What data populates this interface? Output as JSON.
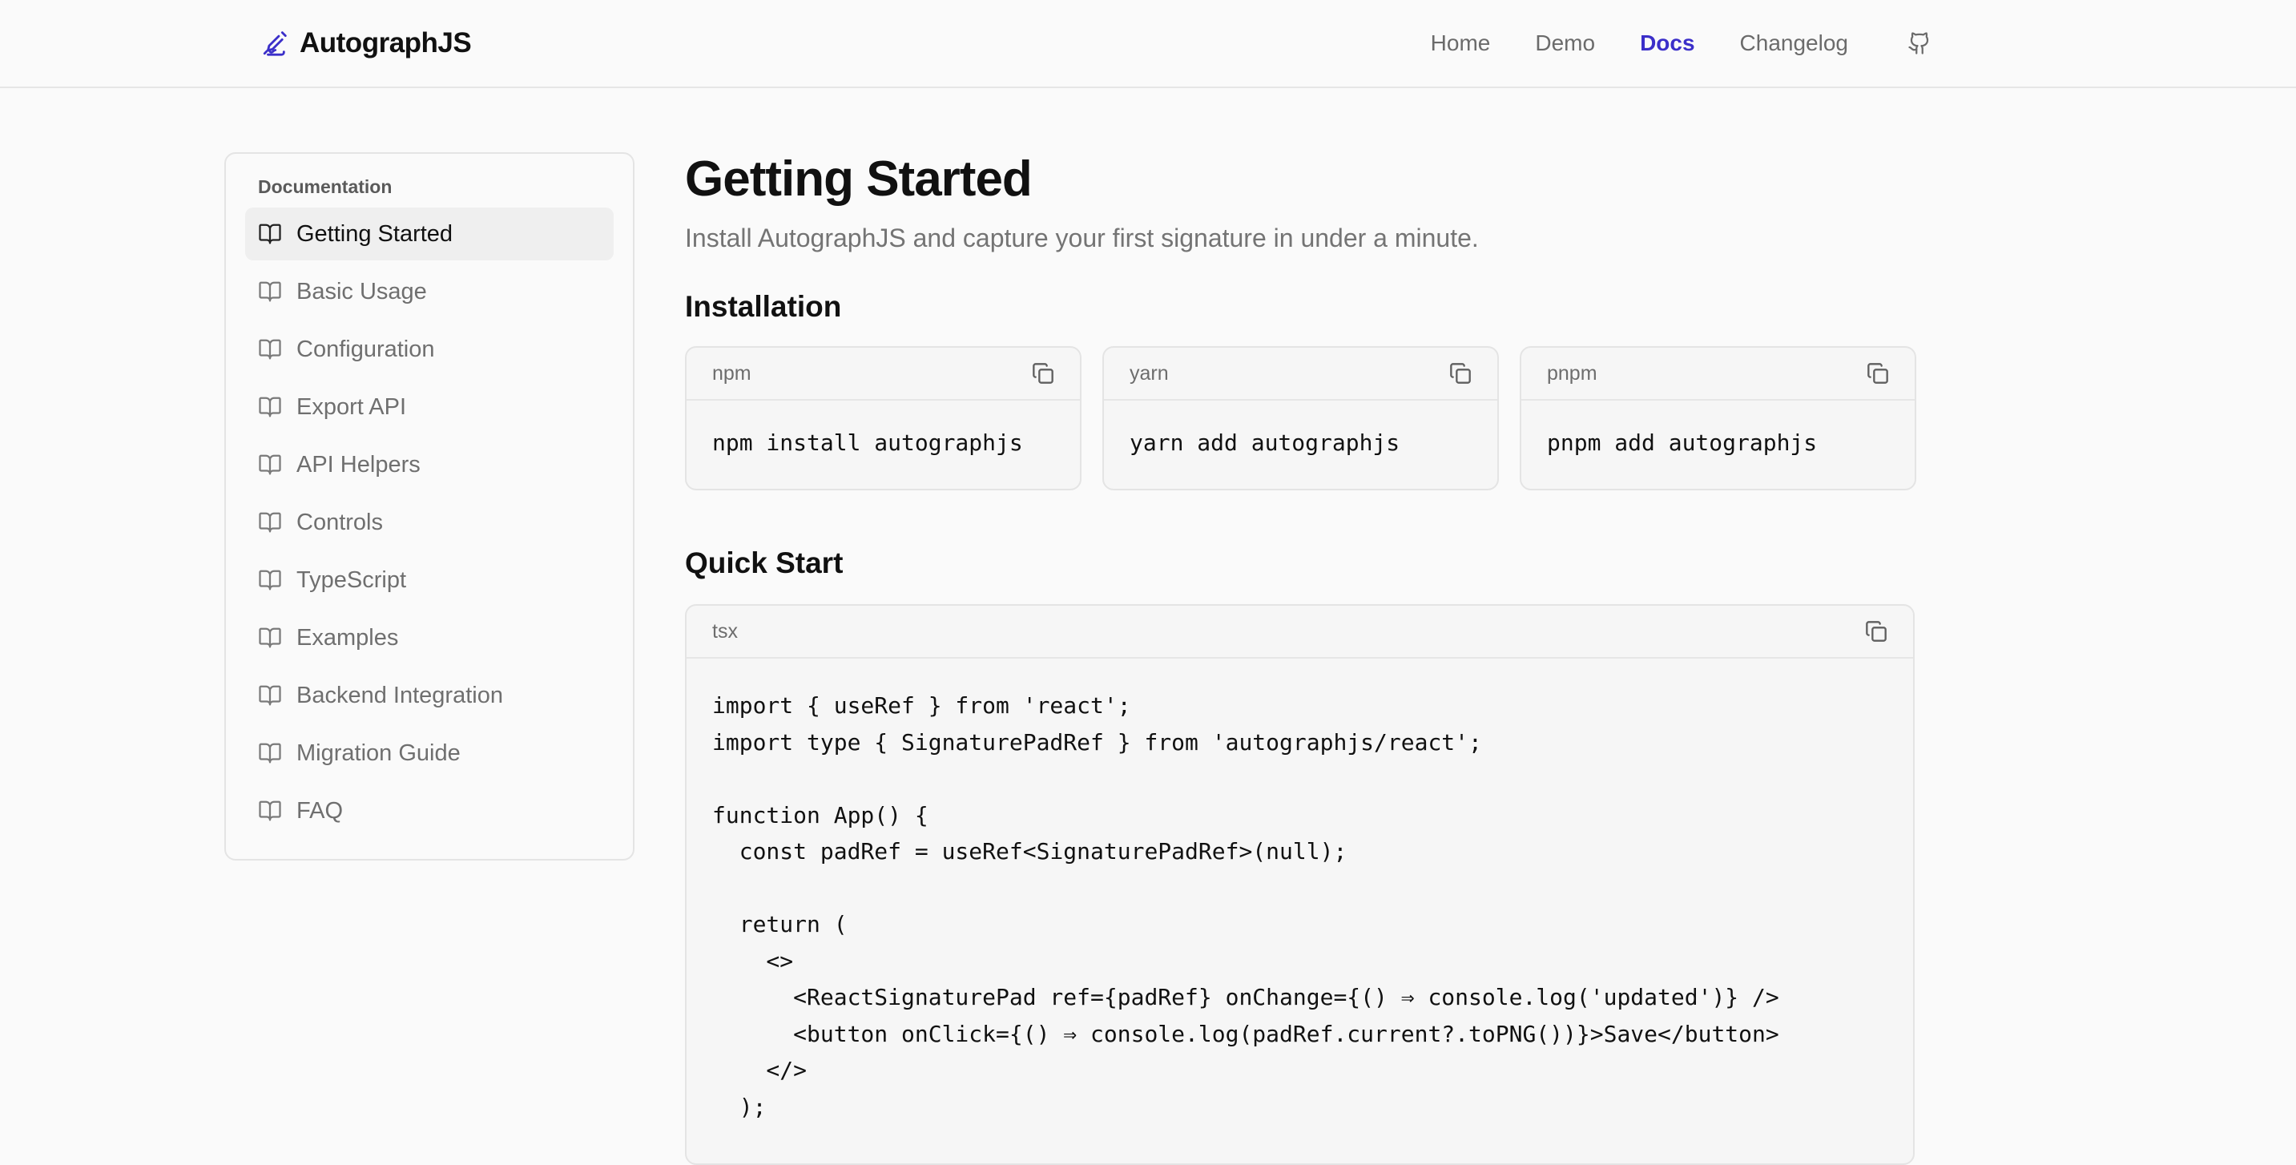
{
  "header": {
    "brand": "AutographJS",
    "nav": [
      {
        "label": "Home",
        "active": false
      },
      {
        "label": "Demo",
        "active": false
      },
      {
        "label": "Docs",
        "active": true
      },
      {
        "label": "Changelog",
        "active": false
      }
    ],
    "github_icon": "github-icon",
    "logo_icon": "signature-icon"
  },
  "sidebar": {
    "heading": "Documentation",
    "item_icon": "book-icon",
    "items": [
      {
        "label": "Getting Started",
        "active": true
      },
      {
        "label": "Basic Usage",
        "active": false
      },
      {
        "label": "Configuration",
        "active": false
      },
      {
        "label": "Export API",
        "active": false
      },
      {
        "label": "API Helpers",
        "active": false
      },
      {
        "label": "Controls",
        "active": false
      },
      {
        "label": "TypeScript",
        "active": false
      },
      {
        "label": "Examples",
        "active": false
      },
      {
        "label": "Backend Integration",
        "active": false
      },
      {
        "label": "Migration Guide",
        "active": false
      },
      {
        "label": "FAQ",
        "active": false
      }
    ]
  },
  "main": {
    "title": "Getting Started",
    "subtitle": "Install AutographJS and capture your first signature in under a minute.",
    "installation": {
      "title": "Installation",
      "cards": [
        {
          "lang": "npm",
          "code": "npm install autographjs"
        },
        {
          "lang": "yarn",
          "code": "yarn add autographjs"
        },
        {
          "lang": "pnpm",
          "code": "pnpm add autographjs"
        }
      ]
    },
    "quick_start": {
      "title": "Quick Start",
      "lang": "tsx",
      "lines": [
        "import { useRef } from 'react';",
        "import type { SignaturePadRef } from 'autographjs/react';",
        "",
        "function App() {",
        "  const padRef = useRef<SignaturePadRef>(null);",
        "",
        "  return (",
        "    <>",
        "      <ReactSignaturePad ref={padRef} onChange={() ⇒ console.log('updated')} />",
        "      <button onClick={() ⇒ console.log(padRef.current?.toPNG())}>Save</button>",
        "    </>",
        "  );"
      ]
    }
  },
  "colors": {
    "accent": "#3b2fc9",
    "background": "#fafafa",
    "code_background": "#f6f6f6",
    "border": "#e4e4e4"
  }
}
